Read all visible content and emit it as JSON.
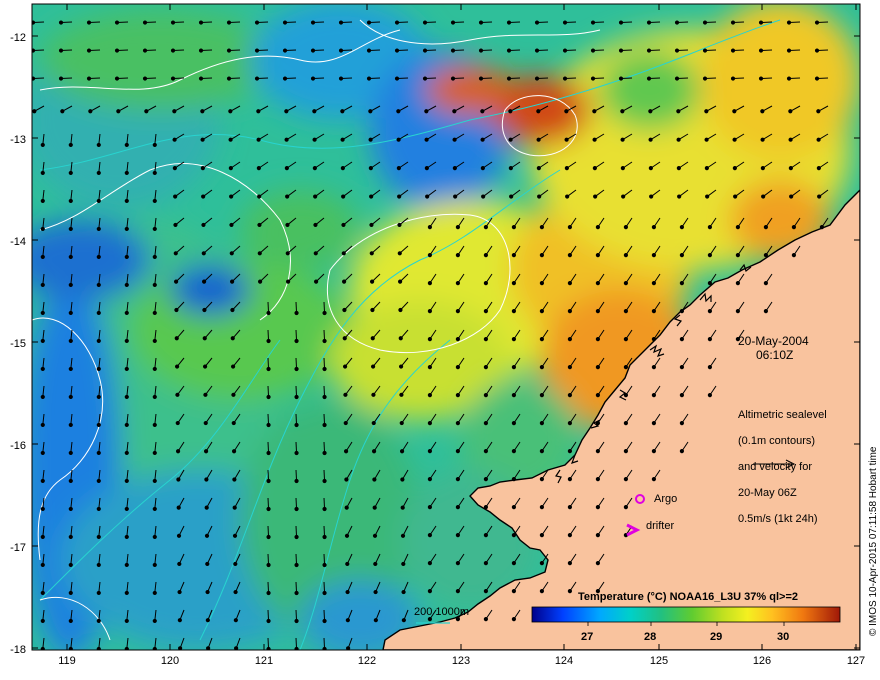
{
  "map": {
    "date": "20-May-2004",
    "time": "06:10Z",
    "altimetry_note": [
      "Altimetric sealevel",
      "(0.1m contours)",
      "and velocity for",
      "20-May 06Z",
      "0.5m/s (1kt 24h)"
    ],
    "argo_label": "Argo",
    "drifter_label": "drifter",
    "bathymetry_label": "200  1000m",
    "credit": "© IMOS 10-Apr-2015 07:11:58 Hobart time"
  },
  "axes": {
    "lat_labels": [
      "-12",
      "-13",
      "-14",
      "-15",
      "-16",
      "-17",
      "-18"
    ],
    "lon_labels": [
      "119",
      "120",
      "121",
      "122",
      "123",
      "124",
      "125",
      "126",
      "127"
    ]
  },
  "colorbar": {
    "title": "Temperature (°C) NOAA16_L3U 37% ql>=2",
    "ticks": [
      "27",
      "28",
      "29",
      "30"
    ],
    "colors": [
      "#00008b",
      "#0044ff",
      "#00aaff",
      "#00d4c8",
      "#22c08a",
      "#5ac840",
      "#b4e020",
      "#f0f020",
      "#ffc020",
      "#f08010",
      "#d04010",
      "#a02008"
    ]
  },
  "colors": {
    "land": "#f9c39e",
    "coast": "#000000",
    "contour": "#ffffff",
    "bathy": "#28d4d0",
    "marker": "#e000e0"
  }
}
